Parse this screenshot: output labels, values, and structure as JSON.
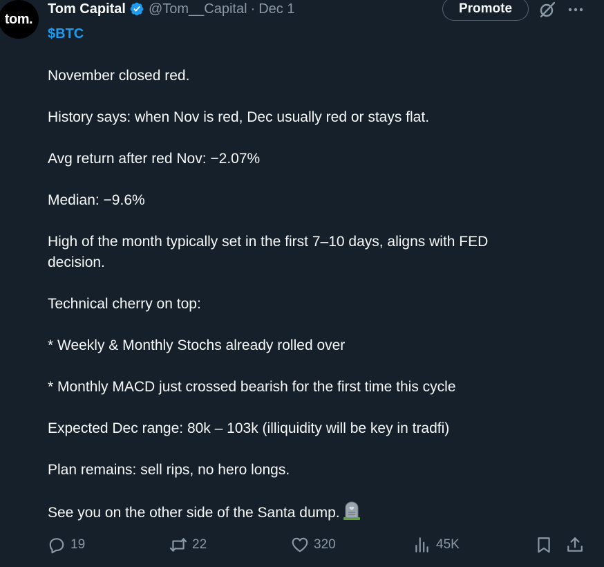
{
  "author": {
    "avatar_text": "tom.",
    "display_name": "Tom Capital",
    "handle": "@Tom__Capital",
    "separator": "·",
    "date": "Dec 1"
  },
  "header_actions": {
    "promote_label": "Promote"
  },
  "tweet": {
    "cashtag": "$BTC",
    "lines": [
      "November closed red.",
      "History says: when Nov is red, Dec usually red or stays flat.",
      "Avg return after red Nov: −2.07%",
      "Median: −9.6%",
      "High of the month typically set in the first 7–10 days, aligns with FED",
      "decision.",
      "Technical cherry on top:",
      "* Weekly & Monthly Stochs already rolled over",
      "* Monthly MACD just crossed bearish for the first time this cycle",
      "Expected Dec range: 80k – 103k (illiquidity will be key in tradfi)",
      "Plan remains: sell rips, no hero longs.",
      "See you on the other side of the Santa dump."
    ]
  },
  "stats": {
    "replies": "19",
    "reposts": "22",
    "likes": "320",
    "views": "45K"
  },
  "icons": {
    "verified": "verified-badge-icon",
    "grok": "grok-icon",
    "more": "more-icon",
    "emoji": "headstone-emoji-icon",
    "reply": "reply-icon",
    "repost": "repost-icon",
    "like": "heart-icon",
    "views": "views-icon",
    "bookmark": "bookmark-icon",
    "share": "share-icon"
  },
  "colors": {
    "background": "#15202b",
    "accent": "#1d9bf0",
    "muted": "#8b98a5",
    "text": "#f7f9f9"
  }
}
